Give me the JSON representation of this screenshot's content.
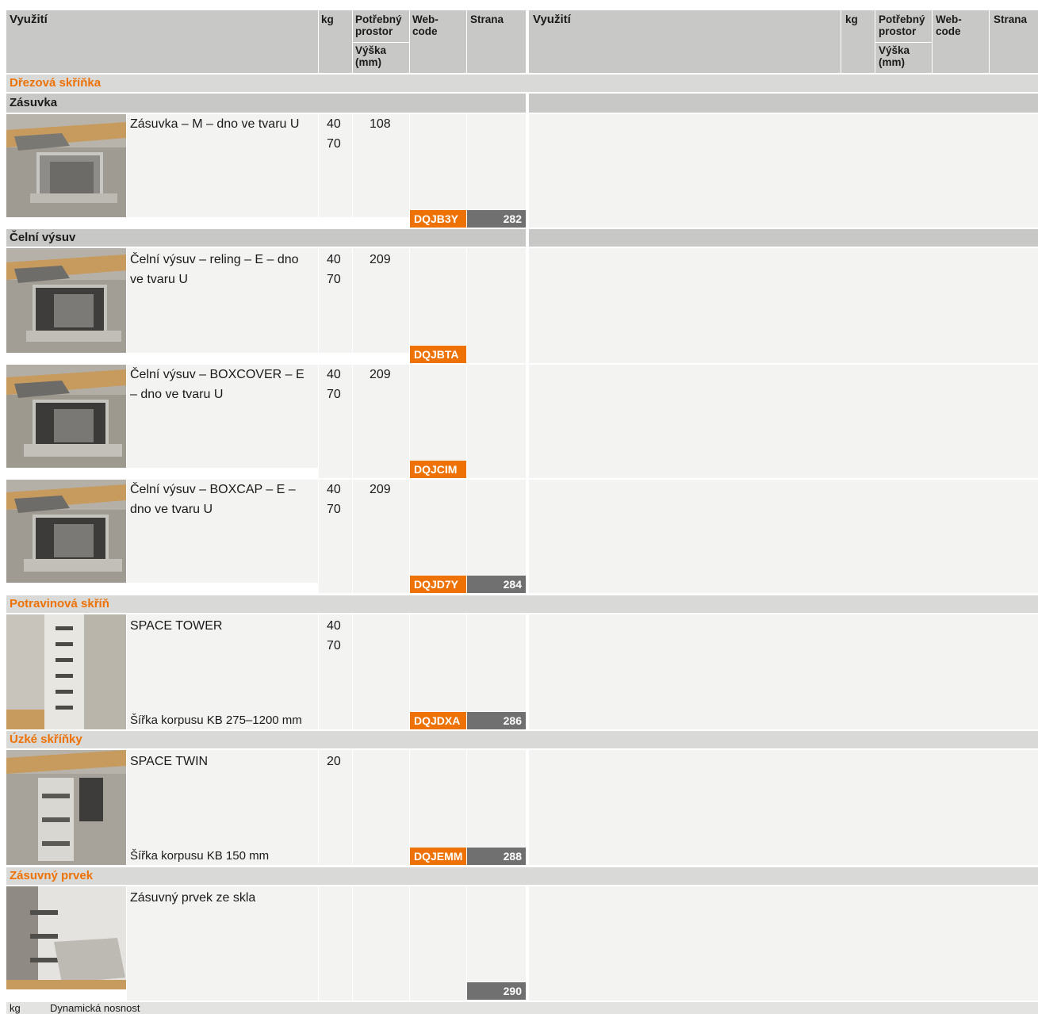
{
  "header": {
    "col_use": "Využití",
    "col_kg": "kg",
    "col_space": "Potřebný prostor",
    "col_height": "Výška (mm)",
    "col_webcode": "Web-code",
    "col_page": "Strana"
  },
  "categories": {
    "sink": "Dřezová skříňka",
    "pantry": "Potravinová skříň",
    "narrow": "Úzké skříňky",
    "insert": "Zásuvný prvek"
  },
  "subcategories": {
    "drawer": "Zásuvka",
    "pullout": "Čelní výsuv"
  },
  "rows": [
    {
      "name": "Zásuvka – M – dno ve tvaru U",
      "kg1": "40",
      "kg2": "70",
      "height": "108",
      "webcode": "DQJB3Y",
      "page": "282",
      "note": ""
    },
    {
      "name": "Čelní výsuv – reling – E – dno ve tvaru U",
      "kg1": "40",
      "kg2": "70",
      "height": "209",
      "webcode": "DQJBTA",
      "page": "",
      "note": ""
    },
    {
      "name": "Čelní výsuv – BOXCOVER – E – dno ve tvaru U",
      "kg1": "40",
      "kg2": "70",
      "height": "209",
      "webcode": "DQJCIM",
      "page": "",
      "note": ""
    },
    {
      "name": "Čelní výsuv – BOXCAP – E – dno ve tvaru U",
      "kg1": "40",
      "kg2": "70",
      "height": "209",
      "webcode": "DQJD7Y",
      "page": "284",
      "note": ""
    },
    {
      "name": "SPACE TOWER",
      "kg1": "40",
      "kg2": "70",
      "height": "",
      "webcode": "DQJDXA",
      "page": "286",
      "note": "Šířka korpusu KB 275–1200 mm"
    },
    {
      "name": "SPACE TWIN",
      "kg1": "20",
      "kg2": "",
      "height": "",
      "webcode": "DQJEMM",
      "page": "288",
      "note": "Šířka korpusu KB 150 mm"
    },
    {
      "name": "Zásuvný prvek ze skla",
      "kg1": "",
      "kg2": "",
      "height": "",
      "webcode": "",
      "page": "290",
      "note": ""
    }
  ],
  "footer": {
    "abbr": "kg",
    "desc": "Dynamická nosnost"
  },
  "colors": {
    "accent": "#ee7203",
    "page_badge": "#707070",
    "header_bg": "#c8c8c6"
  }
}
